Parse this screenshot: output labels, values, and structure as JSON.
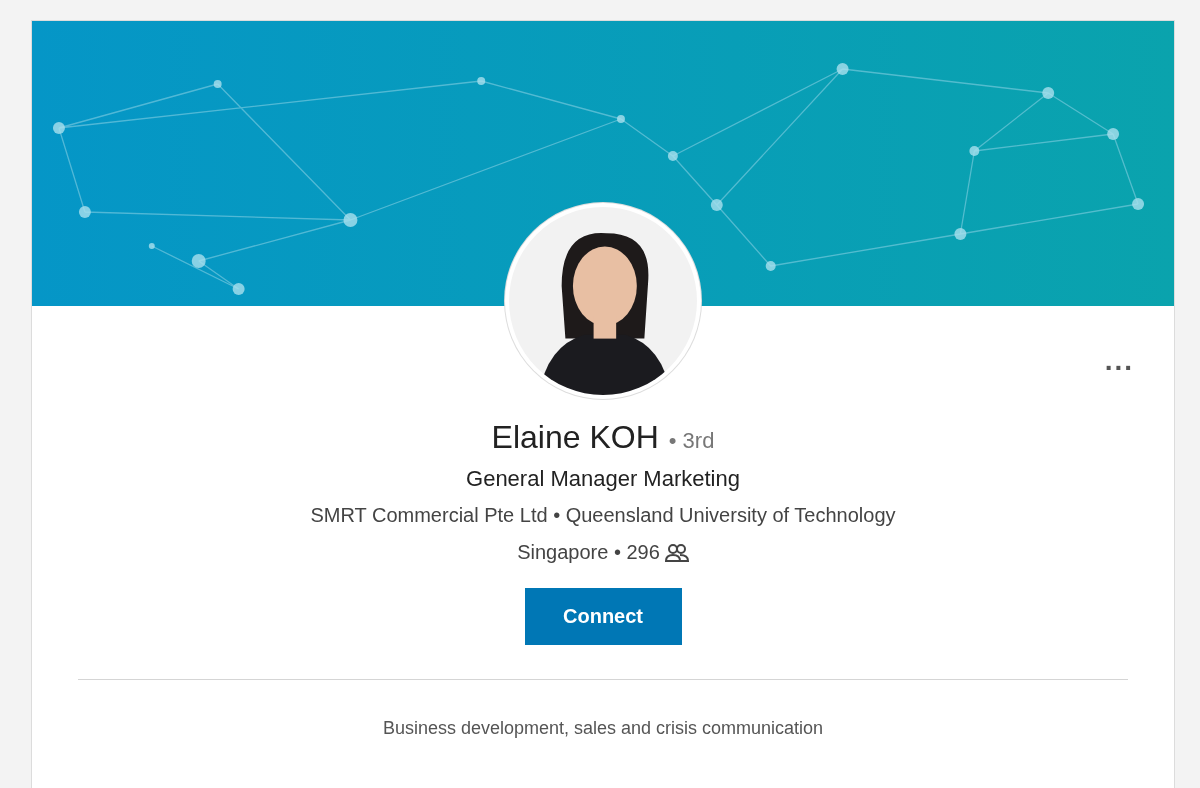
{
  "profile": {
    "name": "Elaine KOH",
    "degree": "• 3rd",
    "headline": "General Manager Marketing",
    "affiliations": "SMRT Commercial Pte Ltd • Queensland University of Technology",
    "location": "Singapore • 296",
    "more": "...",
    "button": "Connect",
    "summary": "Business development, sales and crisis communication"
  }
}
